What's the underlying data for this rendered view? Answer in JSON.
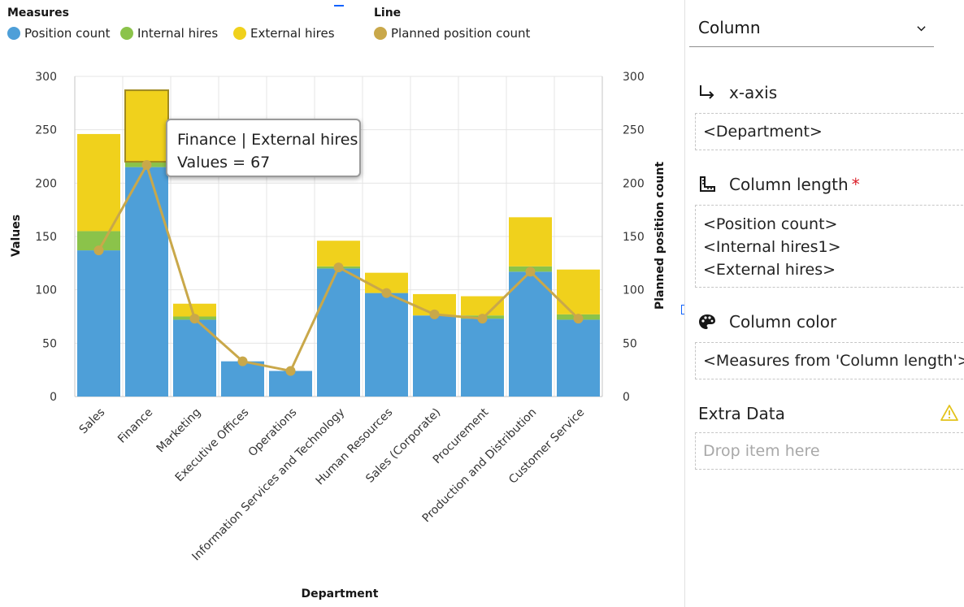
{
  "legend": {
    "measures_title": "Measures",
    "line_title": "Line",
    "items": [
      {
        "label": "Position count",
        "color": "#4e9fd8"
      },
      {
        "label": "Internal hires",
        "color": "#8bc34a"
      },
      {
        "label": "External hires",
        "color": "#f0d11c"
      }
    ],
    "line_item": {
      "label": "Planned position count",
      "color": "#c9a84a"
    }
  },
  "chart_data": {
    "type": "bar",
    "stacked": true,
    "categories": [
      "Sales",
      "Finance",
      "Marketing",
      "Executive Offices",
      "Operations",
      "Information Services and Technology",
      "Human Resources",
      "Sales (Corporate)",
      "Procurement",
      "Production and Distribution",
      "Customer Service"
    ],
    "series": [
      {
        "name": "Position count",
        "color": "#4e9fd8",
        "values": [
          137,
          215,
          72,
          33,
          24,
          120,
          97,
          76,
          73,
          117,
          72
        ]
      },
      {
        "name": "Internal hires",
        "color": "#8bc34a",
        "values": [
          18,
          5,
          3,
          0,
          0,
          2,
          0,
          0,
          3,
          5,
          5
        ]
      },
      {
        "name": "External hires",
        "color": "#f0d11c",
        "values": [
          91,
          67,
          12,
          0,
          0,
          24,
          19,
          20,
          18,
          46,
          42
        ]
      }
    ],
    "line_series": {
      "name": "Planned position count",
      "color": "#c9a84a",
      "values": [
        137,
        217,
        73,
        33,
        24,
        121,
        97,
        77,
        73,
        117,
        73
      ]
    },
    "xlabel": "Department",
    "ylabel": "Values",
    "y2label": "Planned position count",
    "ylim": [
      0,
      300
    ],
    "y2lim": [
      0,
      300
    ],
    "yticks": [
      0,
      50,
      100,
      150,
      200,
      250,
      300
    ],
    "grid": true,
    "highlight": {
      "category": "Finance",
      "series": "External hires"
    }
  },
  "tooltip": {
    "line1": "Finance | External hires",
    "line2": "Values = 67"
  },
  "panel": {
    "chart_type": "Column",
    "xaxis_label": "x-axis",
    "xaxis_value": "<Department>",
    "length_label": "Column length",
    "length_required": "*",
    "length_values": [
      "<Position count>",
      "<Internal hires1>",
      "<External hires>"
    ],
    "color_label": "Column color",
    "color_value": "<Measures from 'Column length'>",
    "extra_label": "Extra Data",
    "extra_placeholder": "Drop item here"
  }
}
